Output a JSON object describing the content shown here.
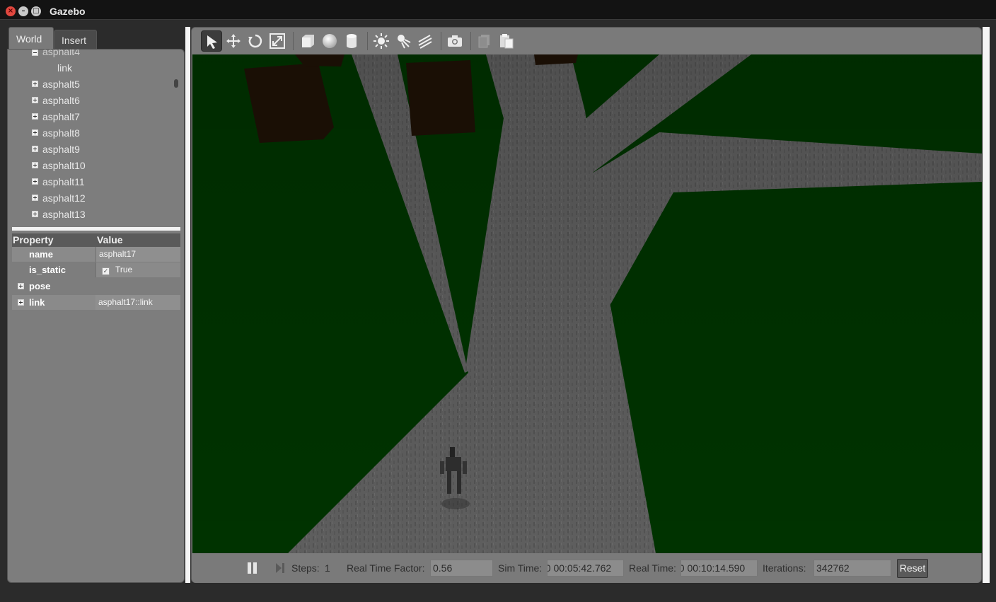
{
  "window": {
    "title": "Gazebo"
  },
  "left_panel": {
    "tabs": [
      {
        "label": "World",
        "active": true
      },
      {
        "label": "Insert",
        "active": false
      }
    ],
    "tree": {
      "partial_item": "asphalt4",
      "child": "link",
      "items": [
        "asphalt5",
        "asphalt6",
        "asphalt7",
        "asphalt8",
        "asphalt9",
        "asphalt10",
        "asphalt11",
        "asphalt12",
        "asphalt13"
      ]
    },
    "properties": {
      "header_property": "Property",
      "header_value": "Value",
      "rows": [
        {
          "key": "name",
          "value": "asphalt17"
        },
        {
          "key": "is_static",
          "value": "True",
          "checked": true
        },
        {
          "key": "pose",
          "value": ""
        },
        {
          "key": "link",
          "value": "asphalt17::link"
        }
      ]
    }
  },
  "toolbar": {
    "tools": [
      "select-arrow-icon",
      "translate-icon",
      "rotate-icon",
      "scale-icon",
      "box-icon",
      "sphere-icon",
      "cylinder-icon",
      "point-light-icon",
      "spot-light-icon",
      "directional-light-icon",
      "screenshot-icon",
      "copy-icon",
      "paste-icon"
    ],
    "active_tool": "select-arrow-icon"
  },
  "bottom_bar": {
    "steps_label": "Steps:",
    "steps_value": "1",
    "rtf_label": "Real Time Factor:",
    "rtf_value": "0.56",
    "sim_time_label": "Sim Time:",
    "sim_time_value": "00 00:05:42.762",
    "real_time_label": "Real Time:",
    "real_time_value": "00 00:10:14.590",
    "iterations_label": "Iterations:",
    "iterations_value": "342762",
    "reset_label": "Reset"
  },
  "colors": {
    "ground": "#003300",
    "road": "#5e5e5e",
    "building": "#1a0f05"
  }
}
